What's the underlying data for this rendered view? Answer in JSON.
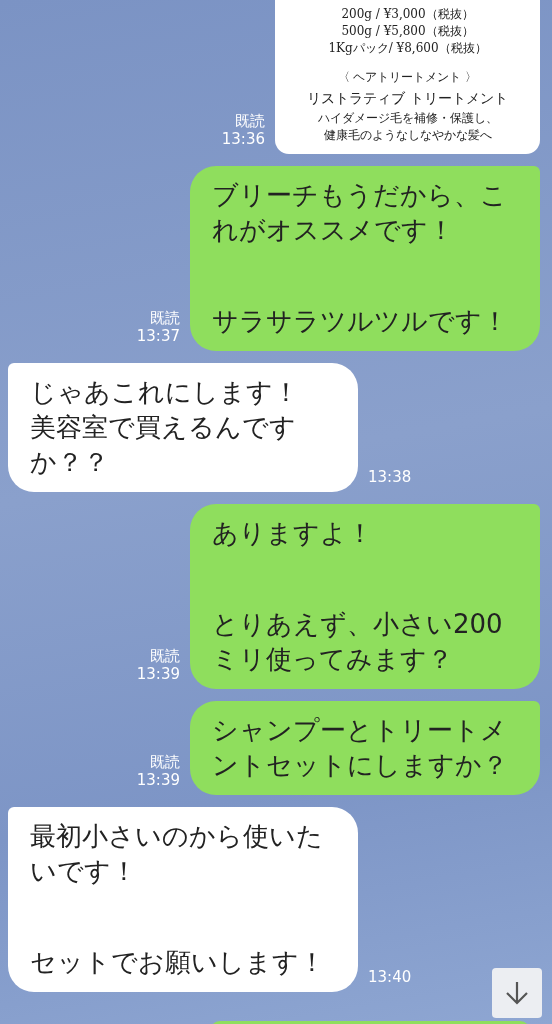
{
  "messages": [
    {
      "kind": "sent_image",
      "read": "既読",
      "time": "13:36",
      "lines": [
        "200g / ¥3,000（税抜）",
        "500g / ¥5,800（税抜）",
        "1Kgパック/ ¥8,600（税抜）",
        "〈 ヘアトリートメント 〉",
        "リストラティブ トリートメント",
        "ハイダメージ毛を補修・保護し、",
        "健康毛のようなしなやかな髪へ"
      ]
    },
    {
      "kind": "sent",
      "read": "既読",
      "time": "13:37",
      "paragraphs": [
        [
          "ブリーチもうだから、これがオススメです！"
        ],
        [
          "サラサラツルツルです！"
        ]
      ]
    },
    {
      "kind": "received",
      "time": "13:38",
      "paragraphs": [
        [
          "じゃあこれにします！",
          "美容室で買えるんですか？？"
        ]
      ]
    },
    {
      "kind": "sent",
      "read": "既読",
      "time": "13:39",
      "paragraphs": [
        [
          "ありますよ！"
        ],
        [
          "とりあえず、小さい200ミリ使ってみます？"
        ]
      ]
    },
    {
      "kind": "sent",
      "read": "既読",
      "time": "13:39",
      "paragraphs": [
        [
          "シャンプーとトリートメントセットにしますか？"
        ]
      ]
    },
    {
      "kind": "received",
      "time": "13:40",
      "paragraphs": [
        [
          "最初小さいのから使いたいです！"
        ],
        [
          "セットでお願いします！"
        ]
      ]
    }
  ]
}
